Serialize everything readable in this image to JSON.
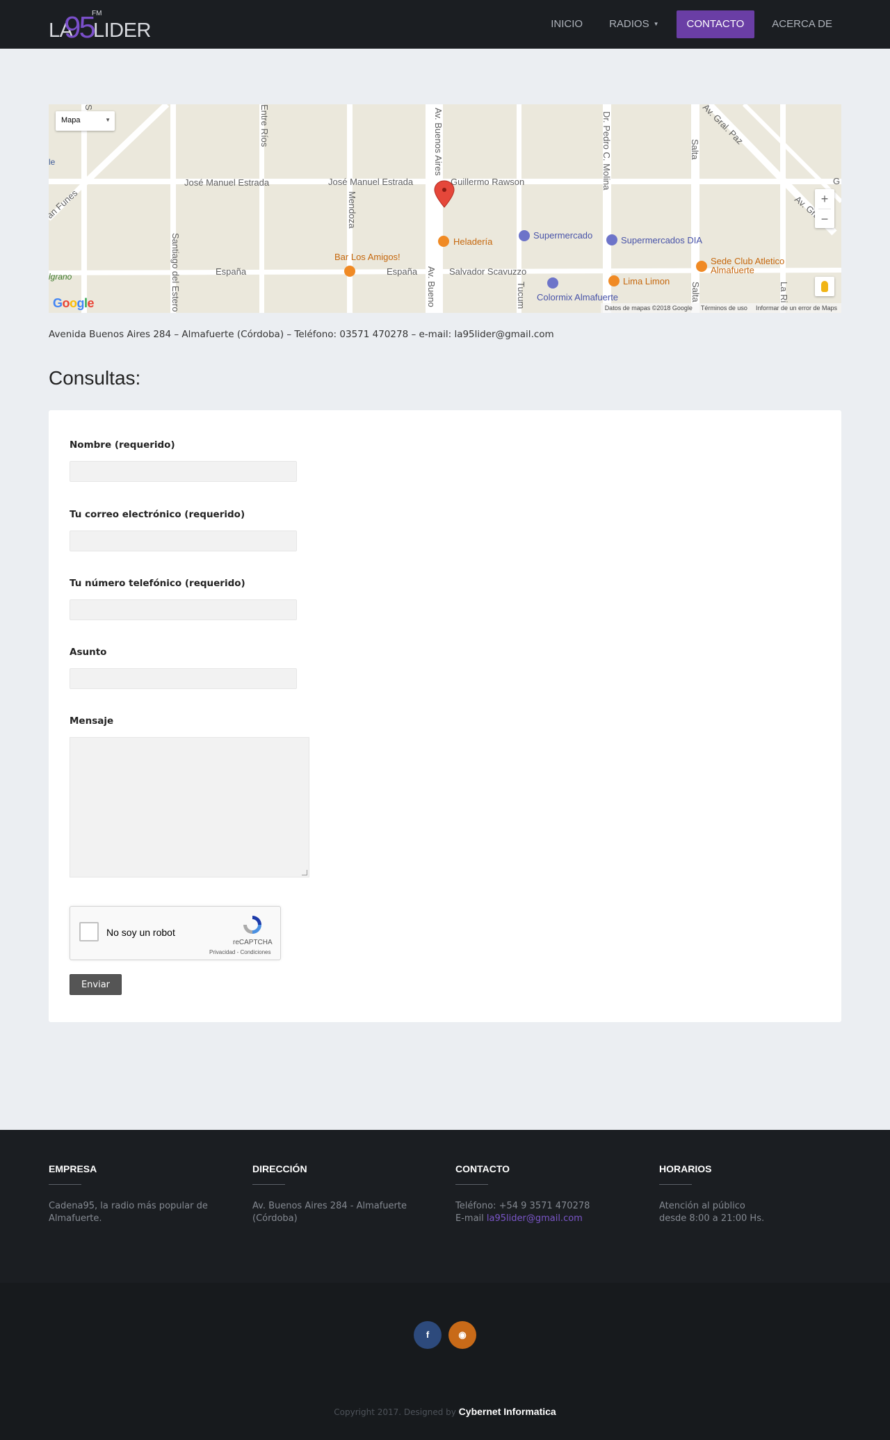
{
  "header": {
    "logo_prefix": "LA",
    "logo_number": "95",
    "logo_suffix": "LIDER",
    "logo_fm": "FM",
    "nav": [
      {
        "label": "INICIO"
      },
      {
        "label": "RADIOS"
      },
      {
        "label": "CONTACTO"
      },
      {
        "label": "ACERCA DE"
      }
    ]
  },
  "map": {
    "type_control": "Mapa",
    "zoom_in": "+",
    "zoom_out": "−",
    "attribution": {
      "data": "Datos de mapas ©2018 Google",
      "terms": "Términos de uso",
      "report": "Informar de un error de Maps"
    },
    "streets": {
      "jose_manuel_estrada_1": "José Manuel Estrada",
      "jose_manuel_estrada_2": "José Manuel Estrada",
      "guillermo_rawson": "Guillermo Rawson",
      "espana_1": "España",
      "espana_2": "España",
      "salvador_scavuzzo": "Salvador Scavuzzo",
      "entre_rios": "Entre Ríos",
      "mendoza": "Mendoza",
      "santiago_del_estero": "Santiago del Estero",
      "av_buenos_aires_top": "Av. Buenos Aires",
      "av_buenos_aires_bottom": "Av. Bueno",
      "dr_pedro_c_molina": "Dr. Pedro C. Molina",
      "salta_top": "Salta",
      "salta_bottom": "Salta",
      "av_gral_paz": "Av. Gral. Paz",
      "av_gral_paz_2": "Av. Gral. P",
      "funes": "an Funes",
      "belgrano": "lgrano",
      "tucuman": "Tucum",
      "la_rioja": "La Ri",
      "ie": "le",
      "g": "G",
      "s_juan": "S"
    },
    "pois": {
      "heladeria": "Heladería",
      "supermercado": "Supermercado",
      "supermercados_dia": "Supermercados DIA",
      "bar_los_amigos": "Bar Los Amigos!",
      "sede_club_1": "Sede Club Atletico",
      "sede_club_2": "Almafuerte",
      "lima_limon": "Lima Limon",
      "colormix": "Colormix Almafuerte"
    },
    "google_logo": [
      "G",
      "o",
      "o",
      "g",
      "l",
      "e"
    ]
  },
  "address": "Avenida Buenos Aires 284 – Almafuerte (Córdoba) – Teléfono: 03571 470278 – e-mail: la95lider@gmail.com",
  "consultas_title": "Consultas:",
  "form": {
    "name_label": "Nombre (requerido)",
    "email_label": "Tu correo electrónico (requerido)",
    "phone_label": "Tu número telefónico (requerido)",
    "subject_label": "Asunto",
    "message_label": "Mensaje",
    "captcha_text": "No soy un robot",
    "captcha_brand": "reCAPTCHA",
    "captcha_links": "Privacidad - Condiciones",
    "submit_label": "Enviar"
  },
  "footer": {
    "empresa_title": "EMPRESA",
    "empresa_text": "Cadena95, la radio más popular de Almafuerte.",
    "direccion_title": "DIRECCIÓN",
    "direccion_text": "Av. Buenos Aires 284 - Almafuerte (Córdoba)",
    "contacto_title": "CONTACTO",
    "contacto_phone": "Teléfono: +54 9 3571 470278",
    "contacto_email_prefix": "E-mail ",
    "contacto_email": "la95lider@gmail.com",
    "horarios_title": "HORARIOS",
    "horarios_line1": "Atención al público",
    "horarios_line2": "desde 8:00 a 21:00 Hs.",
    "social_facebook": "f",
    "social_rss": "◉",
    "copyright": "Copyright 2017. Designed by ",
    "designer": "Cybernet Informatica"
  },
  "colors": {
    "accent": "#6a3ea5",
    "header_bg": "#1b1e22",
    "page_bg": "#ebeef2",
    "map_pin": "#e5473a",
    "poi_orange": "#f08a24",
    "poi_blue": "#6d74c9"
  }
}
